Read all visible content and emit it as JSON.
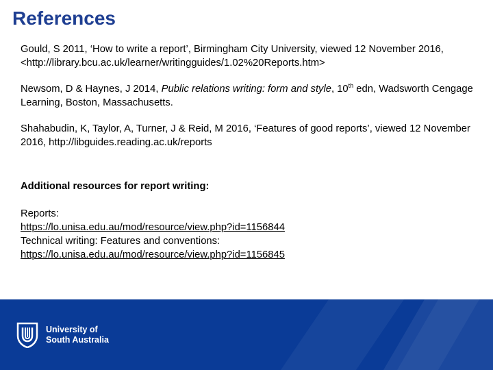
{
  "title": "References",
  "references": [
    {
      "text": "Gould, S 2011, ‘How to write a report’, Birmingham City University, viewed 12 November 2016, <http://library.bcu.ac.uk/learner/writingguides/1.02%20Reports.htm>"
    },
    {
      "before": "Newsom, D & Haynes, J 2014, ",
      "title": "Public relations writing: form and style",
      "edition_before": ", 10",
      "edition_sup": "th",
      "after": " edn, Wadsworth Cengage Learning, Boston, Massachusetts."
    },
    {
      "text": "Shahabudin, K, Taylor, A, Turner, J & Reid, M 2016, ‘Features of good reports’, viewed 12 November 2016, http://libguides.reading.ac.uk/reports"
    }
  ],
  "additional": {
    "heading": "Additional resources for report writing:",
    "items": [
      {
        "label": "Reports:",
        "url": "https://lo.unisa.edu.au/mod/resource/view.php?id=1156844"
      },
      {
        "label": "Technical writing: Features and conventions:",
        "url": "https://lo.unisa.edu.au/mod/resource/view.php?id=1156845"
      }
    ]
  },
  "footer": {
    "logo_line1": "University of",
    "logo_line2": "South Australia",
    "colors": {
      "band": "#0a3b97",
      "accent": "#1f3f92"
    }
  }
}
